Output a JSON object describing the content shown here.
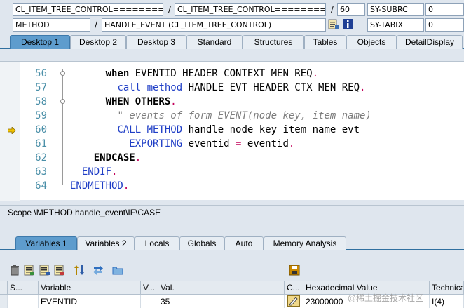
{
  "header": {
    "row1": {
      "program1": "CL_ITEM_TREE_CONTROL==========",
      "program2": "CL_ITEM_TREE_CONTROL==========",
      "line": "60",
      "sysfield1_name": "SY-SUBRC",
      "sysfield1_value": "0",
      "slash": "/"
    },
    "row2": {
      "event_type": "METHOD",
      "event_name": "HANDLE_EVENT (CL_ITEM_TREE_CONTROL)",
      "sysfield2_name": "SY-TABIX",
      "sysfield2_value": "0",
      "slash": "/"
    }
  },
  "desktop_tabs": [
    {
      "label": "Desktop 1",
      "active": true
    },
    {
      "label": "Desktop 2",
      "active": false
    },
    {
      "label": "Desktop 3",
      "active": false
    },
    {
      "label": "Standard",
      "active": false
    },
    {
      "label": "Structures",
      "active": false
    },
    {
      "label": "Tables",
      "active": false
    },
    {
      "label": "Objects",
      "active": false
    },
    {
      "label": "DetailDisplay",
      "active": false
    }
  ],
  "code": {
    "current_line": "60",
    "lines": [
      {
        "num": "56",
        "indent": "      ",
        "tokens": [
          [
            "kw",
            "when "
          ],
          [
            "txt",
            "EVENTID_HEADER_CONTEXT_MEN_REQ"
          ],
          [
            "dot",
            "."
          ]
        ]
      },
      {
        "num": "57",
        "indent": "        ",
        "tokens": [
          [
            "kwb",
            "call method "
          ],
          [
            "txt",
            "HANDLE_EVT_HEADER_CTX_MEN_REQ"
          ],
          [
            "dot",
            "."
          ]
        ]
      },
      {
        "num": "58",
        "indent": "      ",
        "tokens": [
          [
            "kw",
            "WHEN OTHERS"
          ],
          [
            "dot",
            "."
          ]
        ]
      },
      {
        "num": "59",
        "indent": "        ",
        "tokens": [
          [
            "cmt",
            "\" events of form EVENT(node_key, item_name)"
          ]
        ]
      },
      {
        "num": "60",
        "indent": "        ",
        "tokens": [
          [
            "kwb",
            "CALL METHOD "
          ],
          [
            "txt",
            "handle_node_key_item_name_evt"
          ]
        ]
      },
      {
        "num": "61",
        "indent": "          ",
        "tokens": [
          [
            "kwb",
            "EXPORTING "
          ],
          [
            "txt",
            "eventid "
          ],
          [
            "op",
            "= "
          ],
          [
            "txt",
            "eventid"
          ],
          [
            "dot",
            "."
          ]
        ]
      },
      {
        "num": "62",
        "indent": "    ",
        "tokens": [
          [
            "kw",
            "ENDCASE"
          ],
          [
            "dot",
            "."
          ]
        ]
      },
      {
        "num": "63",
        "indent": "  ",
        "tokens": [
          [
            "kwb",
            "ENDIF"
          ],
          [
            "dot",
            "."
          ]
        ]
      },
      {
        "num": "64",
        "indent": "",
        "tokens": [
          [
            "kwb",
            "ENDMETHOD"
          ],
          [
            "dot",
            "."
          ]
        ]
      }
    ]
  },
  "scope": "Scope \\METHOD handle_event\\IF\\CASE",
  "variable_tabs": [
    {
      "label": "Variables 1",
      "active": true
    },
    {
      "label": "Variables 2",
      "active": false
    },
    {
      "label": "Locals",
      "active": false
    },
    {
      "label": "Globals",
      "active": false
    },
    {
      "label": "Auto",
      "active": false
    },
    {
      "label": "Memory Analysis",
      "active": false
    }
  ],
  "toolbar": {
    "icons": [
      "delete-icon",
      "variable-icon",
      "variable-icon",
      "variable-icon",
      "sort-icon",
      "transfer-icon",
      "folder-icon",
      "save-icon"
    ]
  },
  "grid": {
    "columns": [
      "S...",
      "Variable",
      "V...",
      "Val.",
      "C...",
      "Hexadecimal Value",
      "Technica"
    ],
    "rows": [
      {
        "s": "",
        "variable": "EVENTID",
        "v": "",
        "val": "35",
        "c": "",
        "hex": "23000000",
        "tech": "I(4)"
      }
    ]
  },
  "watermark": "@稀土掘金技术社区",
  "colors": {
    "tab_active": "#5e9ccd",
    "keyword_blue": "#1f3ec6",
    "line_number": "#4a8fa8",
    "operator": "#c2005a"
  }
}
